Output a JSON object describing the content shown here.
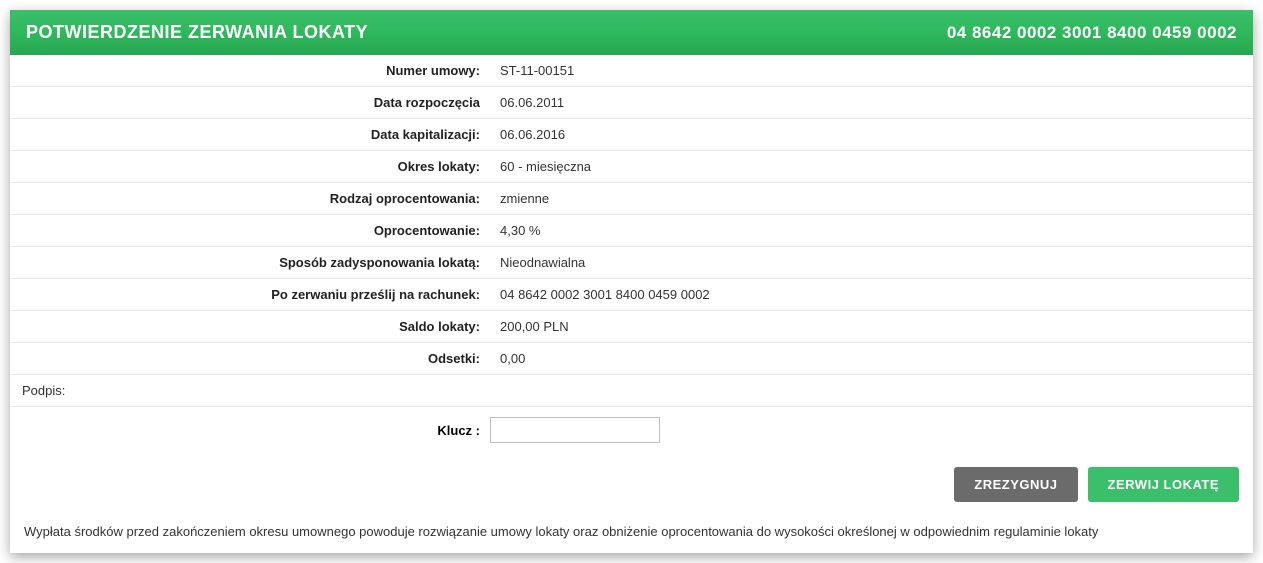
{
  "header": {
    "title": "POTWIERDZENIE ZERWANIA LOKATY",
    "account": "04 8642 0002 3001 8400 0459 0002"
  },
  "details": {
    "contract_number_label": "Numer umowy:",
    "contract_number": "ST-11-00151",
    "start_date_label": "Data rozpoczęcia",
    "start_date": "06.06.2011",
    "capitalization_date_label": "Data kapitalizacji:",
    "capitalization_date": "06.06.2016",
    "deposit_period_label": "Okres lokaty:",
    "deposit_period": "60 - miesięczna",
    "rate_type_label": "Rodzaj oprocentowania:",
    "rate_type": "zmienne",
    "rate_label": "Oprocentowanie:",
    "rate": "4,30 %",
    "disposal_label": "Sposób zadysponowania lokatą:",
    "disposal": "Nieodnawialna",
    "transfer_to_label": "Po zerwaniu prześlij na rachunek:",
    "transfer_to": "04 8642 0002 3001 8400 0459 0002",
    "balance_label": "Saldo lokaty:",
    "balance": "200,00 PLN",
    "interest_label": "Odsetki:",
    "interest": "0,00"
  },
  "signature": {
    "label": "Podpis:",
    "key_label": "Klucz :",
    "key_value": ""
  },
  "actions": {
    "cancel": "ZREZYGNUJ",
    "confirm": "ZERWIJ LOKATĘ"
  },
  "footer_note": "Wypłata środków przed zakończeniem okresu umownego powoduje rozwiązanie umowy lokaty oraz obniżenie oprocentowania do wysokości określonej w odpowiednim regulaminie lokaty"
}
